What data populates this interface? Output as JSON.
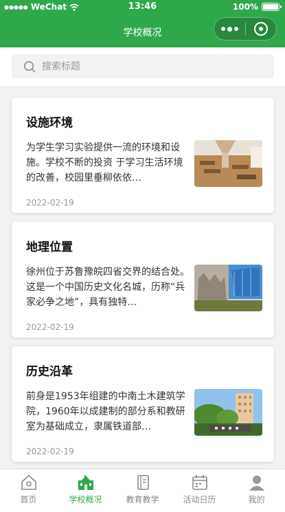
{
  "status_bar": {
    "carrier": "WeChat",
    "time": "13:46",
    "battery": "100%"
  },
  "nav": {
    "title": "学校概况"
  },
  "search": {
    "placeholder": "搜索标题"
  },
  "articles": [
    {
      "title": "设施环境",
      "description": "为学生学习实验提供一流的环境和设施。学校不断的投资 于学习生活环境的改善，校园里垂柳依依…",
      "date": "2022-02-19",
      "image_icon": "facility-photo"
    },
    {
      "title": "地理位置",
      "description": "徐州位于苏鲁豫皖四省交界的结合处。这是一个中国历史文化名城，历称“兵家必争之地”，具有独特…",
      "date": "2022-02-19",
      "image_icon": "location-photo"
    },
    {
      "title": "历史沿革",
      "description": "前身是1953年组建的中南土木建筑学院，1960年以成建制的部分系和教研室为基础成立，隶属铁道部…",
      "date": "2022-02-19",
      "image_icon": "history-photo"
    }
  ],
  "tabbar": {
    "items": [
      {
        "label": "首页",
        "icon": "home-icon",
        "active": false
      },
      {
        "label": "学校概况",
        "icon": "school-icon",
        "active": true
      },
      {
        "label": "教育教学",
        "icon": "book-icon",
        "active": false
      },
      {
        "label": "活动日历",
        "icon": "calendar-icon",
        "active": false
      },
      {
        "label": "我的",
        "icon": "user-icon",
        "active": false
      }
    ]
  },
  "colors": {
    "brand": "#2fa84a",
    "tab_active": "#2fa84a",
    "tab_inactive": "#888888"
  }
}
